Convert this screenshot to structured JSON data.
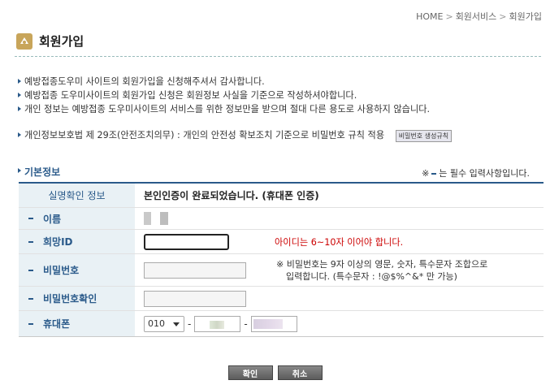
{
  "breadcrumb": [
    "HOME",
    "회원서비스",
    "회원가입"
  ],
  "page_title": "회원가입",
  "notices": [
    "예방접종도우미 사이트의 회원가입을 신청해주셔서 감사합니다.",
    "예방접종 도우미사이트의 회원가입 신청은 회원정보 사실을 기준으로 작성하셔야합니다.",
    "개인 정보는 예방접종 도우미사이트의 서비스를 위한 정보만을 받으며 절대 다른 용도로 사용하지 않습니다."
  ],
  "law": {
    "text": "개인정보보호법 제 29조(안전조치의무) : 개인의 안전성 확보조치 기준으로 비밀번호 규칙 적용",
    "button": "비밀번호 생성규칙"
  },
  "section_title": "기본정보",
  "required_note": {
    "prefix": "※",
    "suffix": "는 필수 입력사항입니다."
  },
  "form": {
    "auth_label": "실명확인 정보",
    "auth_value": "본인인증이 완료되었습니다. (휴대폰 인증)",
    "name_label": "이름",
    "id_label": "희망ID",
    "id_hint": "아이디는 6~10자 이어야 합니다.",
    "pw_label": "비밀번호",
    "pw_hint_line1": "※ 비밀번호는 9자 이상의 영문, 숫자, 특수문자 조합으로",
    "pw_hint_line2": "입력합니다. (특수문자 : !@$%^&* 만 가능)",
    "pw_confirm_label": "비밀번호확인",
    "phone_label": "휴대폰",
    "phone_prefix": "010",
    "phone_sep": "-"
  },
  "buttons": {
    "confirm": "확인",
    "cancel": "취소"
  },
  "colors": {
    "accent": "#2a5a8a",
    "label_bg": "#e9f1f5",
    "error": "#cc0000"
  }
}
